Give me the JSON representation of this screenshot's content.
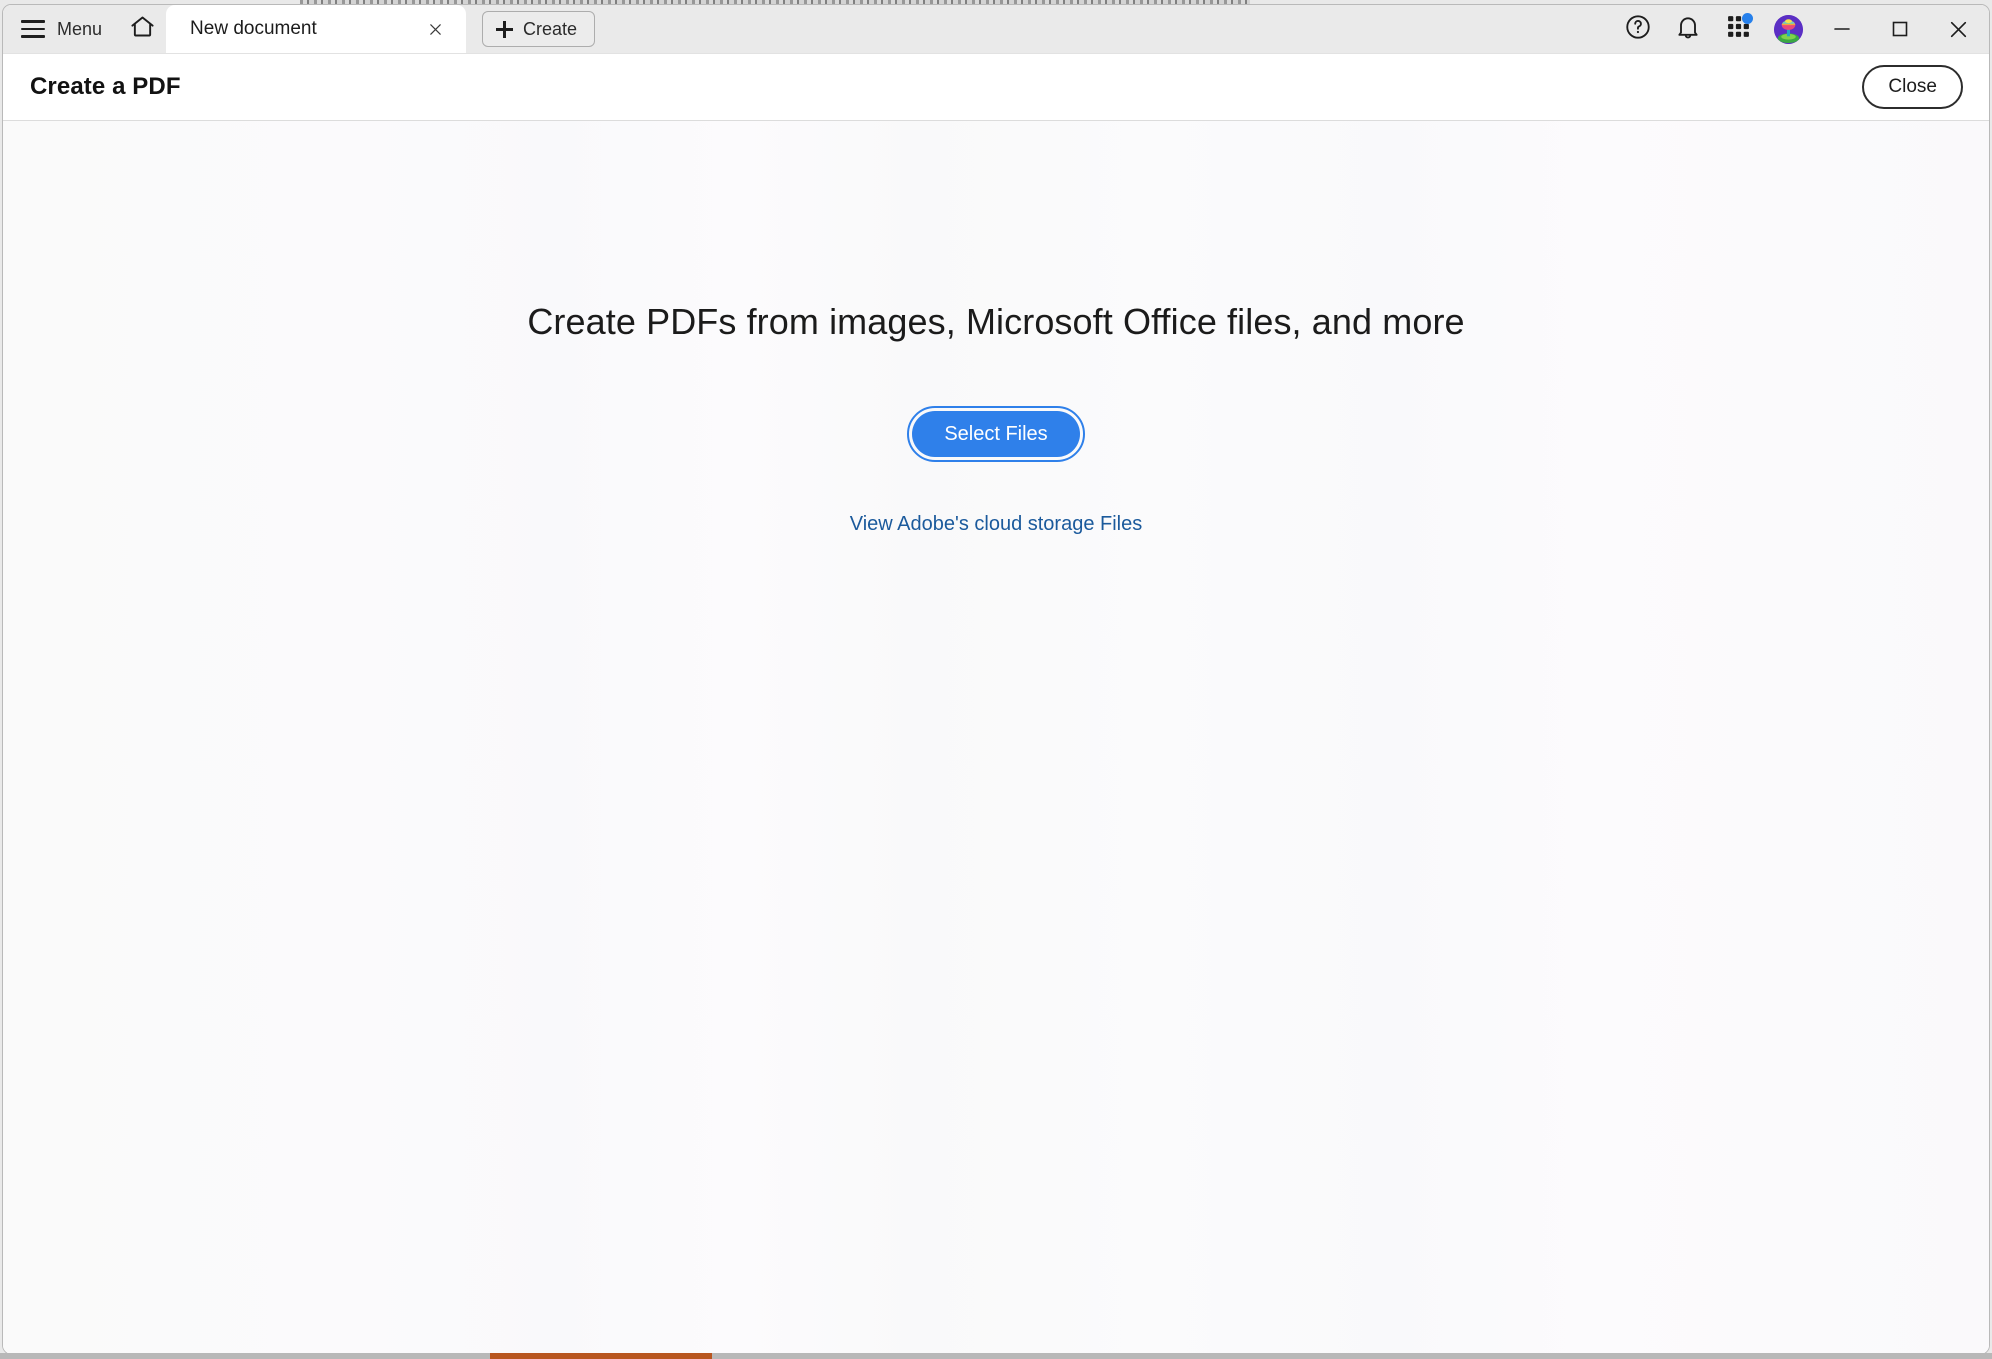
{
  "window": {
    "tabstrip": {
      "menu_label": "Menu",
      "menu_icon": "hamburger-icon",
      "home_icon": "home-icon",
      "tabs": [
        {
          "label": "New document",
          "active": true,
          "close_icon": "close-icon"
        }
      ],
      "create_label": "Create",
      "create_icon": "plus-icon",
      "system_icons": [
        {
          "name": "help-icon",
          "glyph": "?"
        },
        {
          "name": "notifications-bell-icon",
          "glyph": "bell"
        },
        {
          "name": "app-grid-icon",
          "glyph": "grid",
          "badge": true,
          "badge_color": "#2680eb"
        },
        {
          "name": "user-avatar",
          "glyph": "avatar"
        }
      ],
      "window_controls": [
        {
          "name": "minimize-button",
          "glyph": "minimize"
        },
        {
          "name": "maximize-button",
          "glyph": "maximize"
        },
        {
          "name": "close-window-button",
          "glyph": "close"
        }
      ]
    },
    "header": {
      "title": "Create a PDF",
      "close_label": "Close"
    },
    "main": {
      "headline": "Create PDFs from images, Microsoft Office files, and more",
      "select_files_label": "Select Files",
      "cloud_link_label": "View Adobe's cloud storage Files"
    }
  },
  "colors": {
    "accent_blue": "#2f80ea",
    "link_blue": "#1b5a9c",
    "tabstrip_bg": "#eaeaea",
    "content_bg": "#fafafb",
    "taskbar_accent": "#b8561f"
  }
}
